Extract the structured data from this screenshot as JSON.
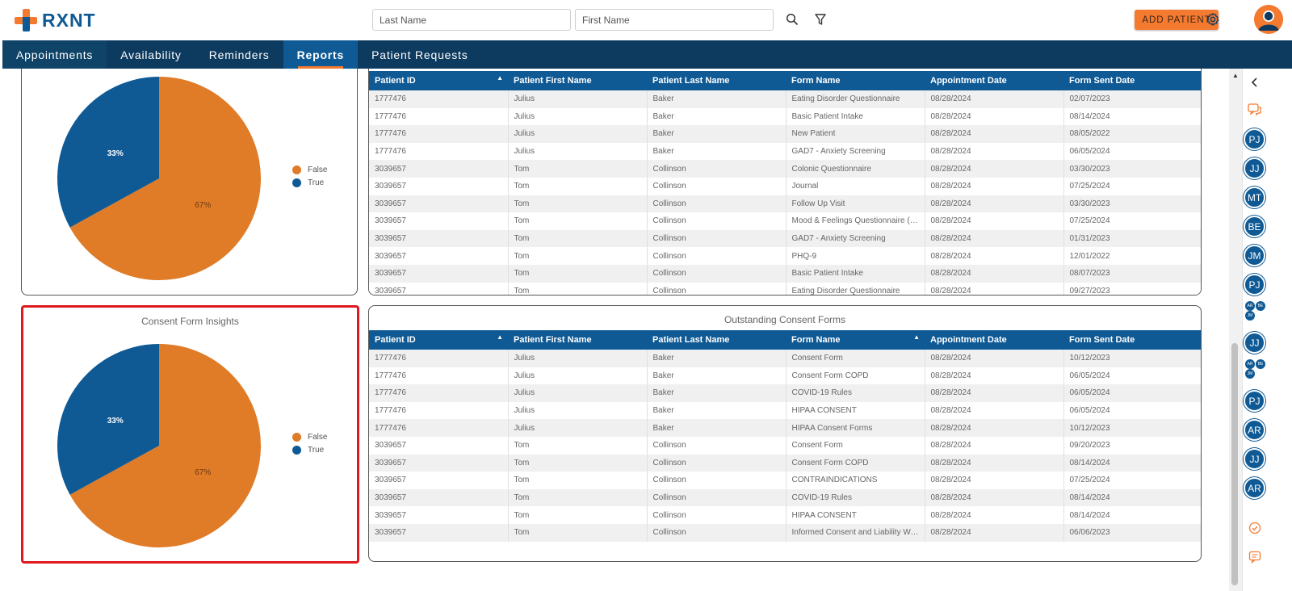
{
  "header": {
    "logo_text": "RXNT",
    "last_name_placeholder": "Last Name",
    "first_name_placeholder": "First Name",
    "add_patient_label": "ADD PATIENT"
  },
  "nav": {
    "items": [
      "Appointments",
      "Availability",
      "Reminders",
      "Reports",
      "Patient Requests"
    ],
    "active": "Reports"
  },
  "top_chart": {
    "chart_data": {
      "type": "pie",
      "title": "",
      "slices": [
        {
          "label": "False",
          "value": 67,
          "display": "67%",
          "color": "#e07b27"
        },
        {
          "label": "True",
          "value": 33,
          "display": "33%",
          "color": "#0f5a95"
        }
      ],
      "legend_position": "right"
    },
    "legend": [
      "False",
      "True"
    ]
  },
  "top_table": {
    "columns": [
      "Patient ID",
      "Patient First Name",
      "Patient Last Name",
      "Form Name",
      "Appointment Date",
      "Form Sent Date"
    ],
    "rows": [
      [
        "1777476",
        "Julius",
        "Baker",
        "Eating Disorder Questionnaire",
        "08/28/2024",
        "02/07/2023"
      ],
      [
        "1777476",
        "Julius",
        "Baker",
        "Basic Patient Intake",
        "08/28/2024",
        "08/14/2024"
      ],
      [
        "1777476",
        "Julius",
        "Baker",
        "New Patient",
        "08/28/2024",
        "08/05/2022"
      ],
      [
        "1777476",
        "Julius",
        "Baker",
        "GAD7 - Anxiety Screening",
        "08/28/2024",
        "06/05/2024"
      ],
      [
        "3039657",
        "Tom",
        "Collinson",
        "Colonic Questionnaire",
        "08/28/2024",
        "03/30/2023"
      ],
      [
        "3039657",
        "Tom",
        "Collinson",
        "Journal",
        "08/28/2024",
        "07/25/2024"
      ],
      [
        "3039657",
        "Tom",
        "Collinson",
        "Follow Up Visit",
        "08/28/2024",
        "03/30/2023"
      ],
      [
        "3039657",
        "Tom",
        "Collinson",
        "Mood & Feelings Questionnaire (MFQ...",
        "08/28/2024",
        "07/25/2024"
      ],
      [
        "3039657",
        "Tom",
        "Collinson",
        "GAD7 - Anxiety Screening",
        "08/28/2024",
        "01/31/2023"
      ],
      [
        "3039657",
        "Tom",
        "Collinson",
        "PHQ-9",
        "08/28/2024",
        "12/01/2022"
      ],
      [
        "3039657",
        "Tom",
        "Collinson",
        "Basic Patient Intake",
        "08/28/2024",
        "08/07/2023"
      ],
      [
        "3039657",
        "Tom",
        "Collinson",
        "Eating Disorder Questionnaire",
        "08/28/2024",
        "09/27/2023"
      ]
    ]
  },
  "consent_chart": {
    "title": "Consent Form Insights",
    "chart_data": {
      "type": "pie",
      "title": "Consent Form Insights",
      "slices": [
        {
          "label": "False",
          "value": 67,
          "display": "67%",
          "color": "#e07b27"
        },
        {
          "label": "True",
          "value": 33,
          "display": "33%",
          "color": "#0f5a95"
        }
      ],
      "legend_position": "right"
    },
    "legend": [
      "False",
      "True"
    ]
  },
  "consent_table": {
    "title": "Outstanding Consent Forms",
    "columns": [
      "Patient ID",
      "Patient First Name",
      "Patient Last Name",
      "Form Name",
      "Appointment Date",
      "Form Sent Date"
    ],
    "rows": [
      [
        "1777476",
        "Julius",
        "Baker",
        "Consent Form",
        "08/28/2024",
        "10/12/2023"
      ],
      [
        "1777476",
        "Julius",
        "Baker",
        "Consent Form COPD",
        "08/28/2024",
        "06/05/2024"
      ],
      [
        "1777476",
        "Julius",
        "Baker",
        "COVID-19 Rules",
        "08/28/2024",
        "06/05/2024"
      ],
      [
        "1777476",
        "Julius",
        "Baker",
        "HIPAA CONSENT",
        "08/28/2024",
        "06/05/2024"
      ],
      [
        "1777476",
        "Julius",
        "Baker",
        "HIPAA Consent Forms",
        "08/28/2024",
        "10/12/2023"
      ],
      [
        "3039657",
        "Tom",
        "Collinson",
        "Consent Form",
        "08/28/2024",
        "09/20/2023"
      ],
      [
        "3039657",
        "Tom",
        "Collinson",
        "Consent Form COPD",
        "08/28/2024",
        "08/14/2024"
      ],
      [
        "3039657",
        "Tom",
        "Collinson",
        "CONTRAINDICATIONS",
        "08/28/2024",
        "07/25/2024"
      ],
      [
        "3039657",
        "Tom",
        "Collinson",
        "COVID-19 Rules",
        "08/28/2024",
        "08/14/2024"
      ],
      [
        "3039657",
        "Tom",
        "Collinson",
        "HIPAA CONSENT",
        "08/28/2024",
        "08/14/2024"
      ],
      [
        "3039657",
        "Tom",
        "Collinson",
        "Informed Consent and Liability Waiver",
        "08/28/2024",
        "06/06/2023"
      ]
    ]
  },
  "rail": {
    "avatars": [
      "PJ",
      "JJ",
      "MT",
      "BE",
      "JM",
      "PJ",
      "JJ",
      "PJ",
      "AR",
      "JJ",
      "AR"
    ],
    "mini_groups": [
      [
        "AR",
        "BE",
        "JM"
      ],
      [
        "AR",
        "BE",
        "JM"
      ]
    ]
  }
}
